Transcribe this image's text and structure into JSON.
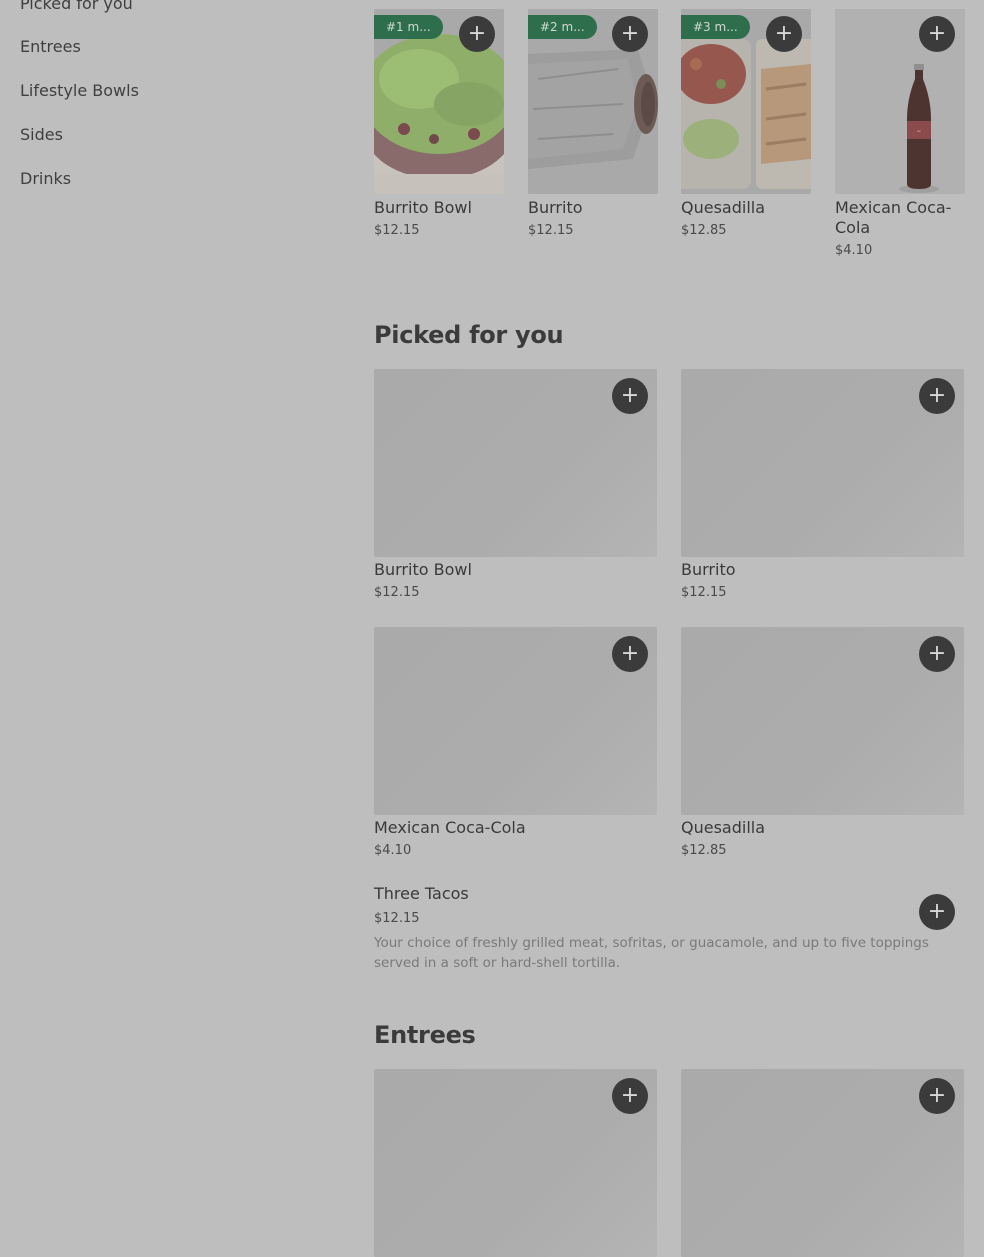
{
  "sidebar": {
    "items": [
      {
        "label": "Picked for you"
      },
      {
        "label": "Entrees"
      },
      {
        "label": "Lifestyle Bowls"
      },
      {
        "label": "Sides"
      },
      {
        "label": "Drinks"
      }
    ]
  },
  "popular": {
    "items": [
      {
        "badge": "#1 m...",
        "name": "Burrito Bowl",
        "price": "$12.15"
      },
      {
        "badge": "#2 m...",
        "name": "Burrito",
        "price": "$12.15"
      },
      {
        "badge": "#3 m...",
        "name": "Quesadilla",
        "price": "$12.85"
      },
      {
        "badge": "",
        "name": "Mexican Coca-Cola",
        "price": "$4.10"
      }
    ]
  },
  "picked": {
    "title": "Picked for you",
    "items": [
      {
        "name": "Burrito Bowl",
        "price": "$12.15"
      },
      {
        "name": "Burrito",
        "price": "$12.15"
      },
      {
        "name": "Mexican Coca-Cola",
        "price": "$4.10"
      },
      {
        "name": "Quesadilla",
        "price": "$12.85"
      }
    ],
    "tacos": {
      "name": "Three Tacos",
      "price": "$12.15",
      "description": "Your choice of freshly grilled meat, sofritas, or guacamole, and up to five toppings served in a soft or hard-shell tortilla."
    }
  },
  "entrees": {
    "title": "Entrees"
  },
  "icons": {
    "add": "plus-icon"
  },
  "colors": {
    "badge": "#2f6e4c",
    "button": "#3b3b3b",
    "overlay_background": "#bebebe"
  }
}
